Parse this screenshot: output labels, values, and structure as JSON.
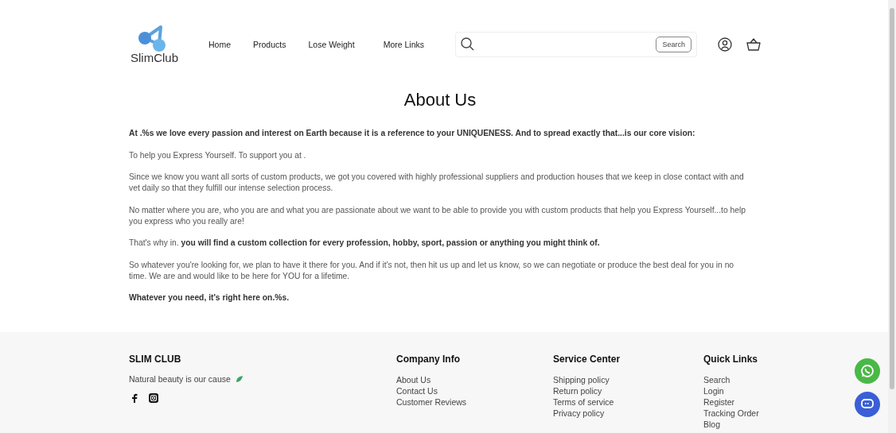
{
  "header": {
    "logo": "SlimClub",
    "nav": [
      {
        "label": "Home"
      },
      {
        "label": "Products"
      },
      {
        "label": "Lose Weight"
      },
      {
        "label": "More Links"
      }
    ],
    "search": {
      "button": "Search"
    }
  },
  "page": {
    "title": "About Us",
    "paragraphs": [
      {
        "text": "At .%s we love every passion and interest on Earth because it is a reference to your UNIQUENESS. And to spread exactly that...is our core vision:",
        "bold": true
      },
      {
        "text": "To help you Express Yourself. To support you at .",
        "bold": false
      },
      {
        "text": "Since we know you want all sorts of custom products, we got you covered with highly professional suppliers and production houses that we keep in close contact with and vet daily so that they fulfill our intense selection process.",
        "bold": false
      },
      {
        "text": "No matter where you are, who you are and what you are passionate about we want to be able to provide you with custom products that help you Express Yourself...to help you express who you really are!",
        "bold": false
      },
      {
        "text": "That's why in. **you will find a custom collection for every profession, hobby, sport, passion or anything you might think of.**",
        "bold": false
      },
      {
        "text": "So whatever you're looking for, we plan to have it there for you. And if it's not, then hit us up and let us know, so we can negotiate or produce the best deal for you in no time. We are and would like to be here for YOU for a lifetime.",
        "bold": false
      },
      {
        "text": "Whatever you need, it's right here on.%s.",
        "bold": true
      }
    ]
  },
  "footer": {
    "brand": "SLIM CLUB",
    "tagline": "Natural beauty is our cause",
    "columns": [
      {
        "title": "Company Info",
        "links": [
          "About Us",
          "Contact Us",
          "Customer Reviews"
        ]
      },
      {
        "title": "Service Center",
        "links": [
          "Shipping policy",
          "Return policy",
          "Terms of service",
          "Privacy policy"
        ]
      },
      {
        "title": "Quick Links",
        "links": [
          "Search",
          "Login",
          "Register",
          "Tracking Order",
          "Blog"
        ]
      }
    ]
  }
}
